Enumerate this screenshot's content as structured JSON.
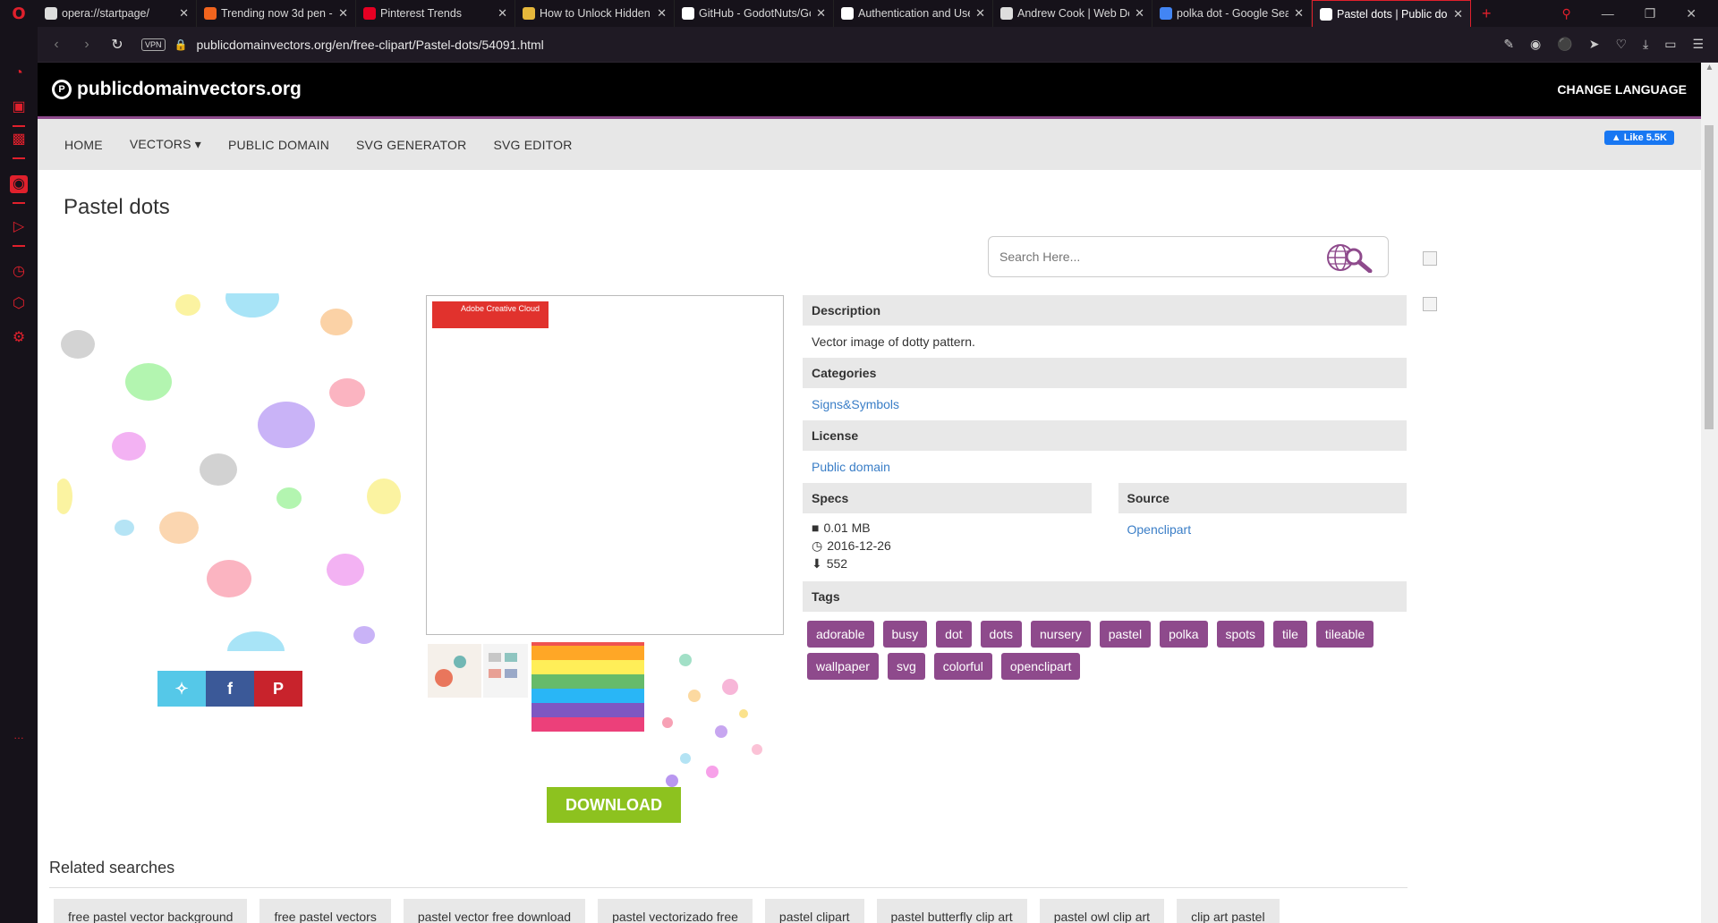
{
  "browser": {
    "tabs": [
      {
        "title": "opera://startpage/",
        "favicon": "grid-icon",
        "color": "#ddd"
      },
      {
        "title": "Trending now 3d pen -",
        "favicon": "etsy-icon",
        "color": "#f1641e"
      },
      {
        "title": "Pinterest Trends",
        "favicon": "pinterest-icon",
        "color": "#e60023"
      },
      {
        "title": "How to Unlock Hidden",
        "favicon": "hat-icon",
        "color": "#e5b73b"
      },
      {
        "title": "GitHub - GodotNuts/Gc",
        "favicon": "github-icon",
        "color": "#fff"
      },
      {
        "title": "Authentication and Use",
        "favicon": "github-icon",
        "color": "#fff"
      },
      {
        "title": "Andrew Cook | Web De",
        "favicon": "globe-icon",
        "color": "#ddd"
      },
      {
        "title": "polka dot - Google Sea",
        "favicon": "google-icon",
        "color": "#4285f4"
      },
      {
        "title": "Pastel dots | Public dom",
        "favicon": "site-icon",
        "color": "#fff",
        "active": true
      }
    ],
    "url": "publicdomainvectors.org/en/free-clipart/Pastel-dots/54091.html",
    "vpn_label": "VPN"
  },
  "site": {
    "logo": "publicdomainvectors.org",
    "change_language": "CHANGE LANGUAGE",
    "nav": [
      "HOME",
      "VECTORS ▾",
      "PUBLIC DOMAIN",
      "SVG GENERATOR",
      "SVG EDITOR"
    ],
    "fb_like": "Like 5.5K"
  },
  "page": {
    "title": "Pastel dots",
    "search_placeholder": "Search Here...",
    "download": "DOWNLOAD",
    "ad_badge": "Adobe Creative Cloud"
  },
  "info": {
    "description_head": "Description",
    "description": "Vector image of dotty pattern.",
    "categories_head": "Categories",
    "category": "Signs&Symbols",
    "license_head": "License",
    "license": "Public domain",
    "specs_head": "Specs",
    "size": "0.01 MB",
    "date": "2016-12-26",
    "downloads": "552",
    "source_head": "Source",
    "source": "Openclipart",
    "tags_head": "Tags",
    "tags": [
      "adorable",
      "busy",
      "dot",
      "dots",
      "nursery",
      "pastel",
      "polka",
      "spots",
      "tile",
      "tileable",
      "wallpaper",
      "svg",
      "colorful",
      "openclipart"
    ]
  },
  "related": {
    "title": "Related searches",
    "items": [
      "free pastel vector background",
      "free pastel vectors",
      "pastel vector free download",
      "pastel vectorizado free",
      "pastel clipart",
      "pastel butterfly clip art",
      "pastel owl clip art",
      "clip art pastel"
    ]
  },
  "colors": {
    "accent": "#8e4a8c",
    "download": "#8dc21f",
    "opera_red": "#e0202c",
    "link": "#3a7ec7"
  }
}
